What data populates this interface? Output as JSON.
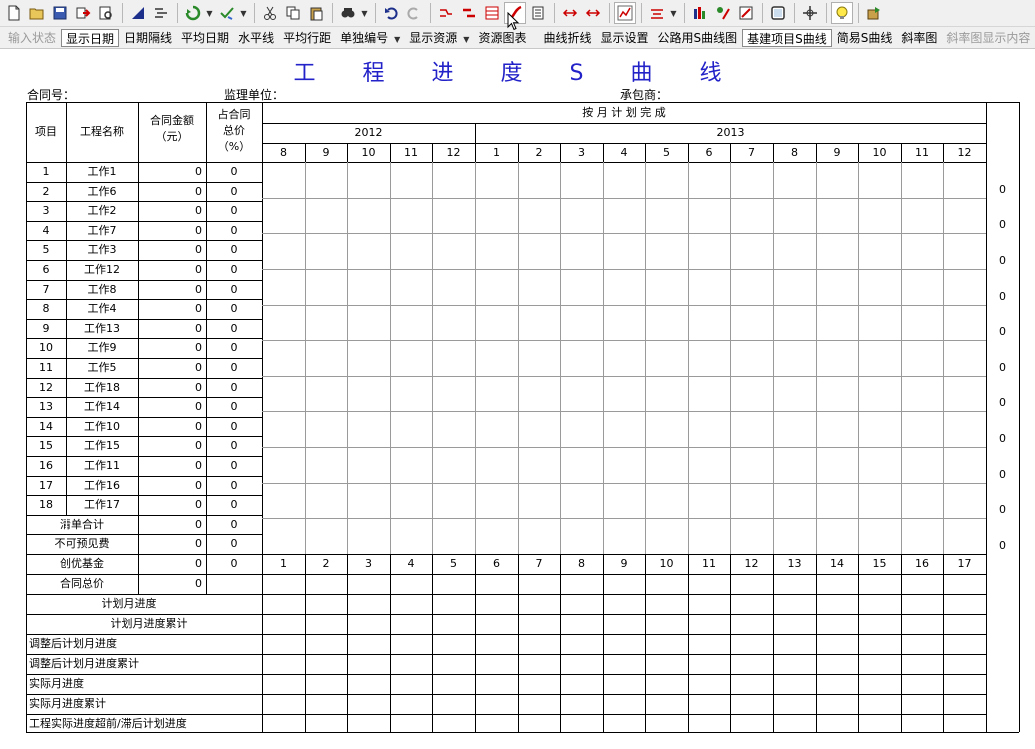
{
  "toolbar": {
    "icons": [
      "new-file-icon",
      "open-folder-icon",
      "save-icon",
      "export-icon",
      "print-preview-icon",
      "triangle-icon",
      "align-icon",
      "refresh-icon",
      "check-icon",
      "cut-icon",
      "copy-icon",
      "paste-icon",
      "find-icon",
      "undo-icon",
      "redo-icon",
      "link-icon",
      "bar-icon",
      "table-icon",
      "s-curve-icon",
      "stack-icon",
      "move-left-icon",
      "move-right-icon",
      "chart-icon",
      "level-icon",
      "bar-chart-icon",
      "resource-icon",
      "edit-chart-icon",
      "window-icon",
      "crosshair-icon",
      "bulb-icon",
      "exit-icon"
    ]
  },
  "menubar": {
    "items": [
      {
        "label": "输入状态",
        "disabled": true
      },
      {
        "label": "显示日期",
        "pressed": true
      },
      {
        "label": "日期隔线"
      },
      {
        "label": "平均日期"
      },
      {
        "label": "水平线"
      },
      {
        "label": "平均行距"
      },
      {
        "label": "单独编号",
        "dropdown": true
      },
      {
        "label": "显示资源",
        "dropdown": true
      },
      {
        "label": "资源图表"
      },
      {
        "label": "曲线折线",
        "separator_before": true
      },
      {
        "label": "显示设置"
      },
      {
        "label": "公路用S曲线图"
      },
      {
        "label": "基建项目S曲线",
        "pressed": true
      },
      {
        "label": "简易S曲线"
      },
      {
        "label": "斜率图"
      },
      {
        "label": "斜率图显示内容",
        "disabled": true
      }
    ]
  },
  "doc": {
    "title": "工 程 进 度 S 曲 线",
    "contract_no_label": "合同号：",
    "supervisor_label": "监理单位：",
    "contractor_label": "承包商：",
    "headers": {
      "item": "项目",
      "name": "工程名称",
      "amount_line1": "合同金额",
      "amount_line2": "（元）",
      "ratio_line1": "占合同",
      "ratio_line2": "总价",
      "ratio_line3": "（%）",
      "monthly_plan": "按 月 计 划 完 成",
      "year1": "2012",
      "year2": "2013"
    },
    "months": [
      "8",
      "9",
      "10",
      "11",
      "12",
      "1",
      "2",
      "3",
      "4",
      "5",
      "6",
      "7",
      "8",
      "9",
      "10",
      "11",
      "12"
    ],
    "rows": [
      {
        "no": "1",
        "name": "工作1",
        "amount": "0",
        "ratio": "0"
      },
      {
        "no": "2",
        "name": "工作6",
        "amount": "0",
        "ratio": "0"
      },
      {
        "no": "3",
        "name": "工作2",
        "amount": "0",
        "ratio": "0"
      },
      {
        "no": "4",
        "name": "工作7",
        "amount": "0",
        "ratio": "0"
      },
      {
        "no": "5",
        "name": "工作3",
        "amount": "0",
        "ratio": "0"
      },
      {
        "no": "6",
        "name": "工作12",
        "amount": "0",
        "ratio": "0"
      },
      {
        "no": "7",
        "name": "工作8",
        "amount": "0",
        "ratio": "0"
      },
      {
        "no": "8",
        "name": "工作4",
        "amount": "0",
        "ratio": "0"
      },
      {
        "no": "9",
        "name": "工作13",
        "amount": "0",
        "ratio": "0"
      },
      {
        "no": "10",
        "name": "工作9",
        "amount": "0",
        "ratio": "0"
      },
      {
        "no": "11",
        "name": "工作5",
        "amount": "0",
        "ratio": "0"
      },
      {
        "no": "12",
        "name": "工作18",
        "amount": "0",
        "ratio": "0"
      },
      {
        "no": "13",
        "name": "工作14",
        "amount": "0",
        "ratio": "0"
      },
      {
        "no": "14",
        "name": "工作10",
        "amount": "0",
        "ratio": "0"
      },
      {
        "no": "15",
        "name": "工作15",
        "amount": "0",
        "ratio": "0"
      },
      {
        "no": "16",
        "name": "工作11",
        "amount": "0",
        "ratio": "0"
      },
      {
        "no": "17",
        "name": "工作16",
        "amount": "0",
        "ratio": "0"
      },
      {
        "no": "18",
        "name": "工作17",
        "amount": "0",
        "ratio": "0"
      }
    ],
    "summary_rows": [
      {
        "name": "清单合计",
        "amount": "0",
        "ratio": "0"
      },
      {
        "name": "不可预见费",
        "amount": "0",
        "ratio": "0"
      },
      {
        "name": "创优基金",
        "amount": "0",
        "ratio": "0"
      }
    ],
    "total_row": {
      "name": "合同总价",
      "amount": "0"
    },
    "period_numbers": [
      "1",
      "2",
      "3",
      "4",
      "5",
      "6",
      "7",
      "8",
      "9",
      "10",
      "11",
      "12",
      "13",
      "14",
      "15",
      "16",
      "17"
    ],
    "right_axis": [
      "0",
      "0",
      "0",
      "0",
      "0",
      "0",
      "0",
      "0",
      "0",
      "0",
      "0"
    ],
    "progress_rows": [
      {
        "label": "计划月进度",
        "align": "center"
      },
      {
        "label": "计划月进度累计",
        "align": "center"
      },
      {
        "label": "调整后计划月进度",
        "align": "left"
      },
      {
        "label": "调整后计划月进度累计",
        "align": "left"
      },
      {
        "label": "实际月进度",
        "align": "left"
      },
      {
        "label": "实际月进度累计",
        "align": "left"
      },
      {
        "label": "工程实际进度超前/滞后计划进度",
        "align": "left"
      }
    ]
  },
  "colors": {
    "title": "#2222c8",
    "toolbar_bg": "#f0f0f0"
  }
}
